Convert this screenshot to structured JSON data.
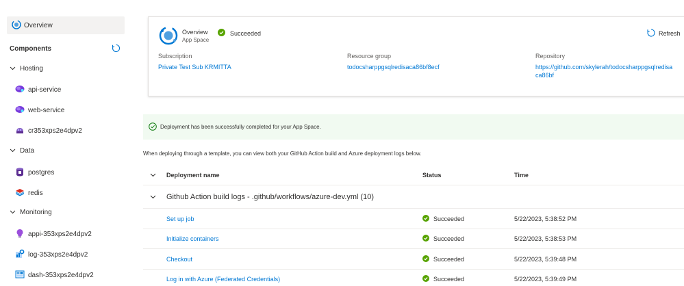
{
  "sidebar": {
    "overview_label": "Overview",
    "components_title": "Components",
    "groups": [
      {
        "label": "Hosting",
        "items": [
          {
            "label": "api-service",
            "icon": "container-app-icon"
          },
          {
            "label": "web-service",
            "icon": "container-app-icon"
          },
          {
            "label": "cr353xps2e4dpv2",
            "icon": "container-registry-icon"
          }
        ]
      },
      {
        "label": "Data",
        "items": [
          {
            "label": "postgres",
            "icon": "postgres-icon"
          },
          {
            "label": "redis",
            "icon": "redis-icon"
          }
        ]
      },
      {
        "label": "Monitoring",
        "items": [
          {
            "label": "appi-353xps2e4dpv2",
            "icon": "app-insights-icon"
          },
          {
            "label": "log-353xps2e4dpv2",
            "icon": "log-analytics-icon"
          },
          {
            "label": "dash-353xps2e4dpv2",
            "icon": "dashboard-icon"
          }
        ]
      }
    ]
  },
  "card": {
    "title": "Overview",
    "subtitle": "App Space",
    "status": "Succeeded",
    "refresh_label": "Refresh",
    "subscription_label": "Subscription",
    "subscription_value": "Private Test Sub KRMITTA",
    "resource_group_label": "Resource group",
    "resource_group_value": "todocsharppgsqlredisaca86bf8ecf",
    "repository_label": "Repository",
    "repository_line1": "https://github.com/skylerah/todocsharppgsqlredisa",
    "repository_line2": "ca86bf"
  },
  "banner": {
    "text": "Deployment has been successfully completed for your App Space."
  },
  "intro_text": "When deploying through a template, you can view both your GitHub Action build and Azure deployment logs below.",
  "table": {
    "headers": {
      "name": "Deployment name",
      "status": "Status",
      "time": "Time"
    },
    "group_label": "Github Action build logs - .github/workflows/azure-dev.yml (10)",
    "rows": [
      {
        "name": "Set up job",
        "status": "Succeeded",
        "time": "5/22/2023, 5:38:52 PM"
      },
      {
        "name": "Initialize containers",
        "status": "Succeeded",
        "time": "5/22/2023, 5:38:53 PM"
      },
      {
        "name": "Checkout",
        "status": "Succeeded",
        "time": "5/22/2023, 5:39:48 PM"
      },
      {
        "name": "Log in with Azure (Federated Credentials)",
        "status": "Succeeded",
        "time": "5/22/2023, 5:39:49 PM"
      }
    ]
  },
  "colors": {
    "accent": "#0078d4",
    "success": "#107c10",
    "banner_bg": "#f1faf1"
  }
}
